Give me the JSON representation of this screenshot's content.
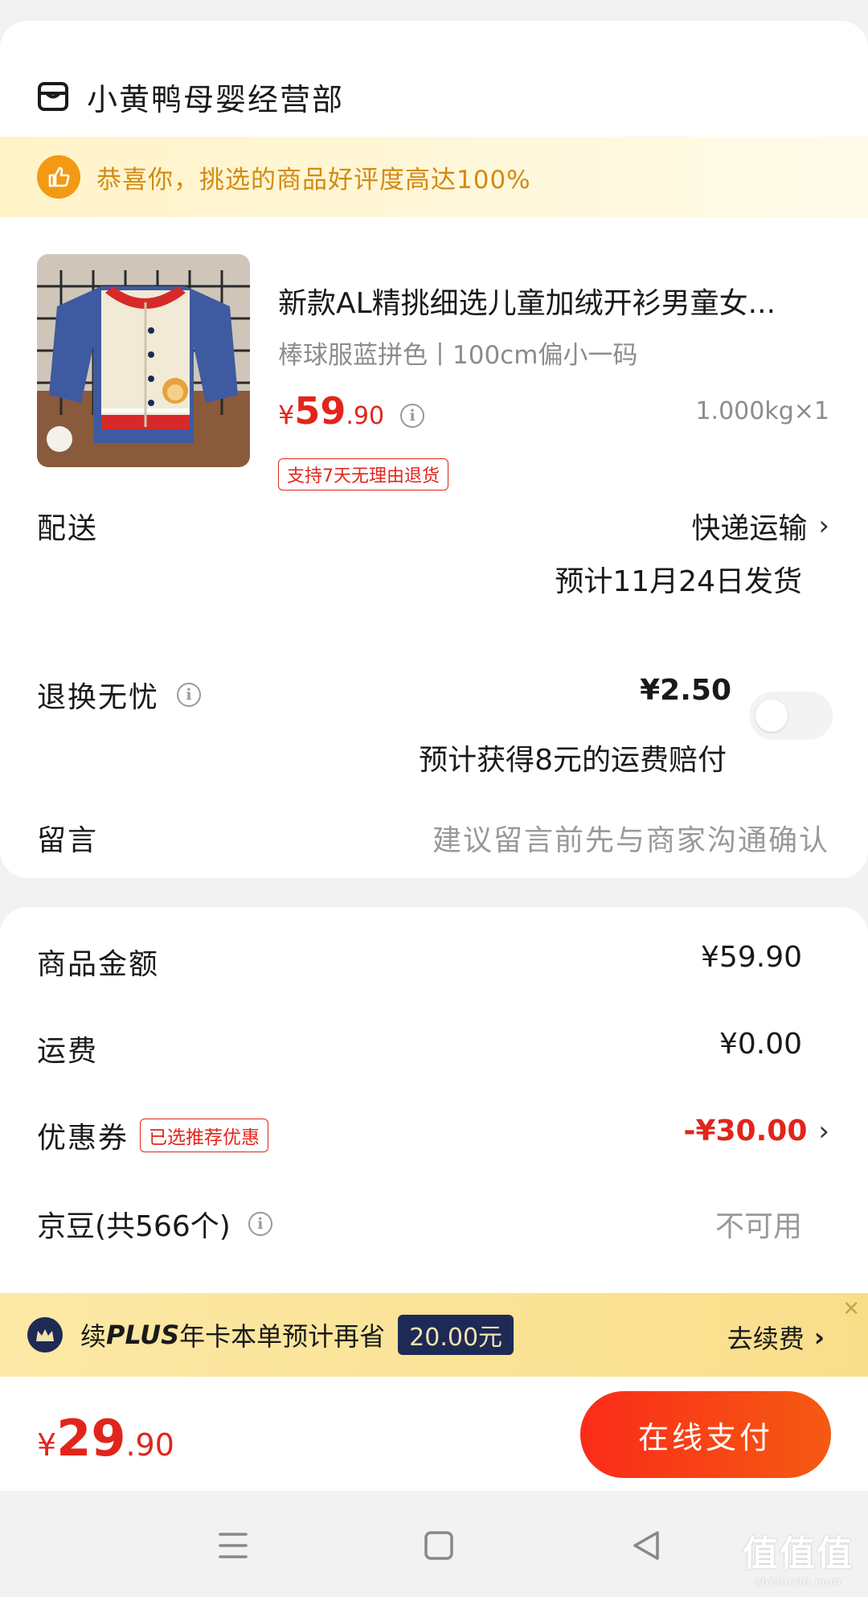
{
  "store": {
    "name": "小黄鸭母婴经营部",
    "icon": "store-icon"
  },
  "banner": {
    "text": "恭喜你，挑选的商品好评度高达100%",
    "icon": "thumbs-up-icon"
  },
  "product": {
    "title": "新款AL精挑细选儿童加绒开衫男童女...",
    "spec": "棒球服蓝拼色丨100cm偏小一码",
    "price_currency": "¥",
    "price_int": "59",
    "price_dec": ".90",
    "weight": "1.000kg×1",
    "return_tag": "支持7天无理由退货"
  },
  "delivery": {
    "label": "配送",
    "method": "快递运输",
    "estimate": "预计11月24日发货"
  },
  "return_insurance": {
    "label": "退换无忧",
    "price": "¥2.50",
    "note": "预计获得8元的运费赔付",
    "enabled": false
  },
  "message": {
    "label": "留言",
    "placeholder": "建议留言前先与商家沟通确认"
  },
  "summary": {
    "goods_label": "商品金额",
    "goods_value": "¥59.90",
    "shipping_label": "运费",
    "shipping_value": "¥0.00",
    "coupon_label": "优惠券",
    "coupon_tag": "已选推荐优惠",
    "coupon_value": "-¥30.00",
    "beans_label": "京豆(共566个)",
    "beans_value": "不可用"
  },
  "plus": {
    "prefix": "续",
    "brand": "PLUS",
    "text": "年卡本单预计再省",
    "amount": "20.00元",
    "action": "去续费",
    "close": "✕"
  },
  "pay": {
    "currency": "¥",
    "total_int": "29",
    "total_dec": ".90",
    "button": "在线支付"
  },
  "watermark": {
    "big": "值值值",
    "small": "zhizhizhi.com"
  },
  "colors": {
    "accent_red": "#e1251b",
    "banner_gold": "#d38a12",
    "plus_navy": "#1e2a55"
  }
}
